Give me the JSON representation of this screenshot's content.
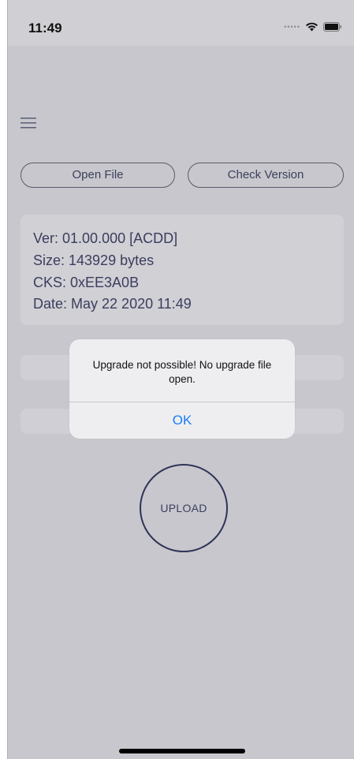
{
  "status_bar": {
    "time": "11:49",
    "signal_icon": "signal-dots-icon",
    "wifi_icon": "wifi-icon",
    "battery_icon": "battery-icon"
  },
  "nav": {
    "menu_icon": "hamburger-menu-icon"
  },
  "buttons": {
    "open_file": "Open File",
    "check_version": "Check Version",
    "upload": "UPLOAD"
  },
  "info": {
    "version": "Ver: 01.00.000 [ACDD]",
    "size": "Size: 143929 bytes",
    "checksum": "CKS: 0xEE3A0B",
    "date": "Date: May 22 2020 11:49"
  },
  "alert": {
    "message": "Upgrade not possible! No upgrade file open.",
    "ok_label": "OK"
  },
  "colors": {
    "background": "#c7c7cd",
    "accent_text": "#3b3d5e",
    "alert_button": "#1a7cf5"
  }
}
